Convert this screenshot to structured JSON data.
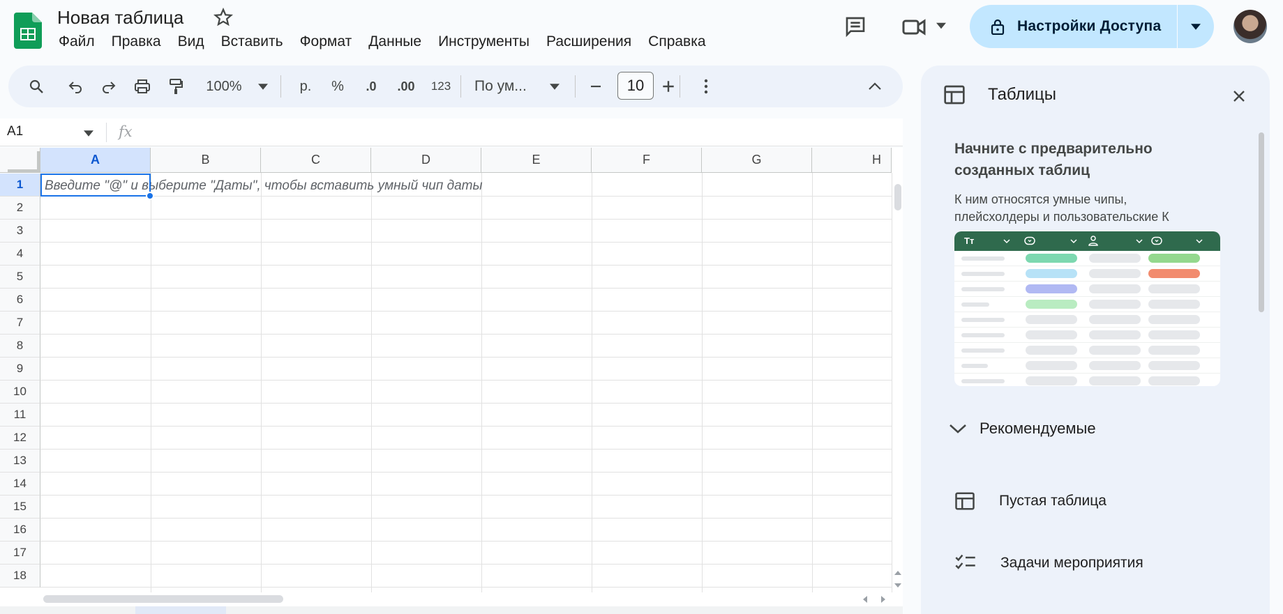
{
  "header": {
    "doc_title": "Новая таблица",
    "menu": [
      "Файл",
      "Правка",
      "Вид",
      "Вставить",
      "Формат",
      "Данные",
      "Инструменты",
      "Расширения",
      "Справка"
    ],
    "share_label": "Настройки Доступа"
  },
  "toolbar": {
    "zoom": "100%",
    "currency": "р.",
    "percent": "%",
    "dec_decrease": ".0",
    "dec_increase": ".00",
    "number_format": "123",
    "font": "По ум...",
    "font_size": "10"
  },
  "formula_bar": {
    "cell_ref": "A1",
    "fx": "fx"
  },
  "sheet": {
    "columns": [
      "A",
      "B",
      "C",
      "D",
      "E",
      "F",
      "G",
      "H"
    ],
    "rows": [
      "1",
      "2",
      "3",
      "4",
      "5",
      "6",
      "7",
      "8",
      "9",
      "10",
      "11",
      "12",
      "13",
      "14",
      "15",
      "16",
      "17",
      "18"
    ],
    "hint": "Введите \"@\" и выберите \"Даты\", чтобы вставить умный чип даты"
  },
  "side_panel": {
    "title": "Таблицы",
    "promo_title": "Начните с предварительно созданных таблиц",
    "promo_desc": "К ним относятся умные чипы, плейсхолдеры и пользовательские К",
    "preview_header": "Tт",
    "section": "Рекомендуемые",
    "items": [
      {
        "label": "Пустая таблица",
        "icon": "table-icon"
      },
      {
        "label": "Задачи мероприятия",
        "icon": "checklist-icon"
      }
    ]
  },
  "colors": {
    "accent": "#1a73e8",
    "share_bg": "#c2e7ff",
    "toolbar_bg": "#edf2fa",
    "preview_header": "#2f6a4d"
  }
}
